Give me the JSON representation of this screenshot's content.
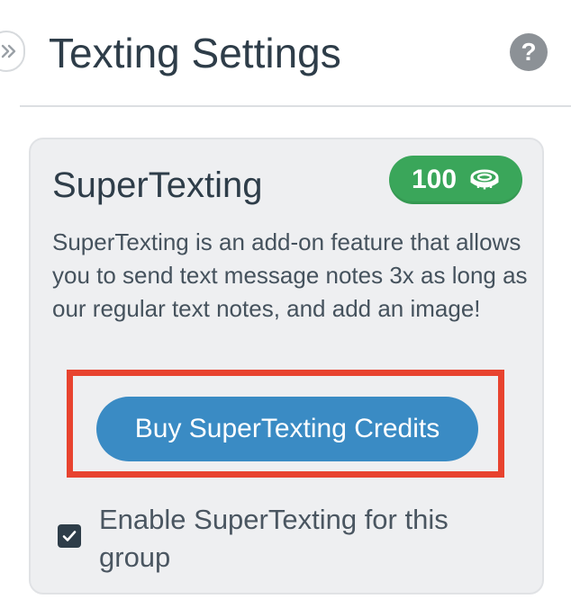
{
  "header": {
    "title": "Texting Settings",
    "help_icon_glyph": "?",
    "expand_icon": "double-chevron-right-icon",
    "help_icon": "question-icon"
  },
  "card": {
    "title": "SuperTexting",
    "credits": {
      "count": "100",
      "icon": "coin-icon",
      "color": "#3aa65a"
    },
    "description": "SuperTexting is an add-on feature that allows you to send text message notes 3x as long as our regular text notes, and add an image!",
    "buy_button_label": "Buy SuperTexting Credits",
    "buy_button_color": "#3a8bc4",
    "highlight_color": "#e8432f",
    "enable_checkbox": {
      "checked": true,
      "label": "Enable SuperTexting for this group"
    }
  }
}
